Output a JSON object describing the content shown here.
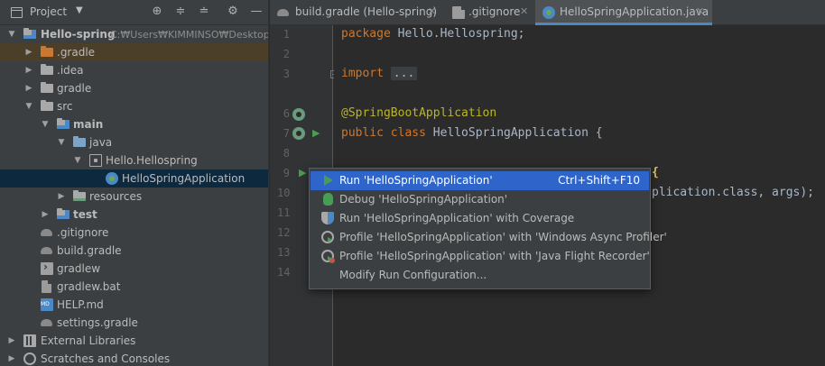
{
  "project_panel": {
    "title": "Project",
    "tree": [
      {
        "label": "Hello-spring",
        "extra": "C:₩Users₩KIMMINSO₩Desktop₩",
        "bold": true,
        "depth": 0,
        "expanded": true,
        "icon": "module-folder-icon"
      },
      {
        "label": ".gradle",
        "depth": 1,
        "expanded": false,
        "icon": "excluded-folder-icon"
      },
      {
        "label": ".idea",
        "depth": 1,
        "expanded": false,
        "icon": "folder-icon"
      },
      {
        "label": "gradle",
        "depth": 1,
        "expanded": false,
        "icon": "folder-icon"
      },
      {
        "label": "src",
        "depth": 1,
        "expanded": true,
        "icon": "folder-icon"
      },
      {
        "label": "main",
        "bold": true,
        "depth": 2,
        "expanded": true,
        "icon": "module-folder-icon"
      },
      {
        "label": "java",
        "depth": 3,
        "expanded": true,
        "icon": "source-folder-icon"
      },
      {
        "label": "Hello.Hellospring",
        "depth": 4,
        "expanded": true,
        "icon": "package-icon"
      },
      {
        "label": "HelloSpringApplication",
        "depth": 5,
        "icon": "spring-class-icon",
        "selected": true
      },
      {
        "label": "resources",
        "depth": 3,
        "expanded": false,
        "icon": "resources-folder-icon"
      },
      {
        "label": "test",
        "bold": true,
        "depth": 2,
        "expanded": false,
        "icon": "module-folder-icon"
      },
      {
        "label": ".gitignore",
        "depth": 1,
        "icon": "gitignore-file-icon"
      },
      {
        "label": "build.gradle",
        "depth": 1,
        "icon": "gradle-file-icon"
      },
      {
        "label": "gradlew",
        "depth": 1,
        "icon": "terminal-file-icon"
      },
      {
        "label": "gradlew.bat",
        "depth": 1,
        "icon": "text-file-icon"
      },
      {
        "label": "HELP.md",
        "depth": 1,
        "icon": "markdown-file-icon"
      },
      {
        "label": "settings.gradle",
        "depth": 1,
        "icon": "gradle-file-icon"
      },
      {
        "label": "External Libraries",
        "depth": 0,
        "expanded": false,
        "icon": "libraries-icon"
      },
      {
        "label": "Scratches and Consoles",
        "depth": 0,
        "expanded": false,
        "icon": "scratches-icon"
      }
    ]
  },
  "tabs": [
    {
      "label": "build.gradle (Hello-spring)",
      "icon": "gradle-file-icon",
      "active": false
    },
    {
      "label": ".gitignore",
      "icon": "gitignore-file-icon",
      "active": false
    },
    {
      "label": "HelloSpringApplication.java",
      "icon": "spring-class-icon",
      "active": true
    }
  ],
  "editor": {
    "line_numbers": [
      "1",
      "2",
      "3",
      "6",
      "7",
      "8",
      "9",
      "10",
      "11",
      "12",
      "13",
      "14"
    ],
    "lines": {
      "package_kw": "package",
      "package_name": " Hello.Hellospring;",
      "import_kw": "import",
      "import_fold": "...",
      "annotation": "@SpringBootApplication",
      "class_kw": "public class",
      "class_name": " HelloSpringApplication {",
      "line9_visible": "{",
      "line10_visible": "plication.class, args);"
    }
  },
  "run_popup": {
    "items": [
      {
        "label": "Run 'HelloSpringApplication'",
        "shortcut": "Ctrl+Shift+F10",
        "icon": "run-icon",
        "selected": true
      },
      {
        "label": "Debug 'HelloSpringApplication'",
        "shortcut": "",
        "icon": "debug-icon"
      },
      {
        "label": "Run 'HelloSpringApplication' with Coverage",
        "shortcut": "",
        "icon": "coverage-icon"
      },
      {
        "label": "Profile 'HelloSpringApplication' with 'Windows Async Profiler'",
        "shortcut": "",
        "icon": "profiler-icon"
      },
      {
        "label": "Profile 'HelloSpringApplication' with 'Java Flight Recorder'",
        "shortcut": "",
        "icon": "flight-recorder-icon"
      },
      {
        "label": "Modify Run Configuration...",
        "shortcut": "",
        "icon": ""
      }
    ]
  },
  "colors": {
    "selection_tree": "#0d293e",
    "selection_popup": "#2f65ca",
    "keyword": "#cc7832",
    "annotation": "#bbb529",
    "run_green": "#499c54"
  }
}
